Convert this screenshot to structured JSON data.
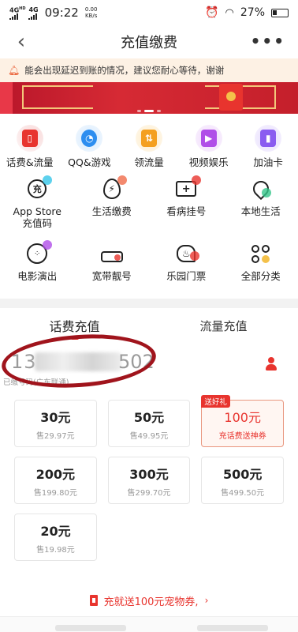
{
  "status_bar": {
    "network1": "4G",
    "network1_sup": "HD",
    "network2": "4G",
    "time": "09:22",
    "speed_value": "0.00",
    "speed_unit": "KB/s",
    "battery": "27%"
  },
  "nav": {
    "title": "充值缴费",
    "back_glyph": "‹",
    "more_glyph": "•••"
  },
  "notice": {
    "text": "能会出现延迟到账的情况，建议您耐心等待，谢谢"
  },
  "services": {
    "row1": [
      {
        "label": "话费&流量",
        "icon": "phone-bill-icon",
        "color": "#e8342e"
      },
      {
        "label": "QQ&游戏",
        "icon": "qq-icon",
        "color": "#2d8ef0"
      },
      {
        "label": "领流量",
        "icon": "traffic-card-icon",
        "color": "#f4a020"
      },
      {
        "label": "视频娱乐",
        "icon": "video-icon",
        "color": "#b04ee8"
      },
      {
        "label": "加油卡",
        "icon": "fuel-card-icon",
        "color": "#8a5cf0"
      }
    ],
    "row2": [
      {
        "label": "App Store\n充值码",
        "label_line1": "App Store",
        "label_line2": "充值码",
        "icon": "app-store-icon"
      },
      {
        "label": "生活缴费",
        "icon": "utility-bill-icon"
      },
      {
        "label": "看病挂号",
        "icon": "medical-kit-icon"
      },
      {
        "label": "本地生活",
        "icon": "location-pin-icon"
      }
    ],
    "row3": [
      {
        "label": "电影演出",
        "icon": "film-reel-icon"
      },
      {
        "label": "宽带靓号",
        "icon": "router-icon"
      },
      {
        "label": "乐园门票",
        "icon": "ticket-icon"
      },
      {
        "label": "全部分类",
        "icon": "grid-categories-icon"
      }
    ]
  },
  "tabs": [
    {
      "label": "话费充值",
      "active": true
    },
    {
      "label": "流量充值",
      "active": false
    }
  ],
  "phone": {
    "prefix": "13",
    "suffix": "502",
    "subtitle": "已缴号码(广东联通)"
  },
  "amounts": [
    {
      "amount": "30元",
      "sale": "售29.97元"
    },
    {
      "amount": "50元",
      "sale": "售49.95元"
    },
    {
      "amount": "100元",
      "sale": "充话费送神券",
      "badge": "送好礼",
      "highlight": true
    },
    {
      "amount": "200元",
      "sale": "售199.80元"
    },
    {
      "amount": "300元",
      "sale": "售299.70元"
    },
    {
      "amount": "500元",
      "sale": "售499.50元"
    },
    {
      "amount": "20元",
      "sale": "售19.98元"
    }
  ],
  "promo": {
    "text": "充就送100元宠物券,",
    "chevron": "›"
  },
  "colors": {
    "accent": "#e8342e",
    "notice_bg": "#fdf1e4",
    "circle_annotation": "#a0141c"
  }
}
